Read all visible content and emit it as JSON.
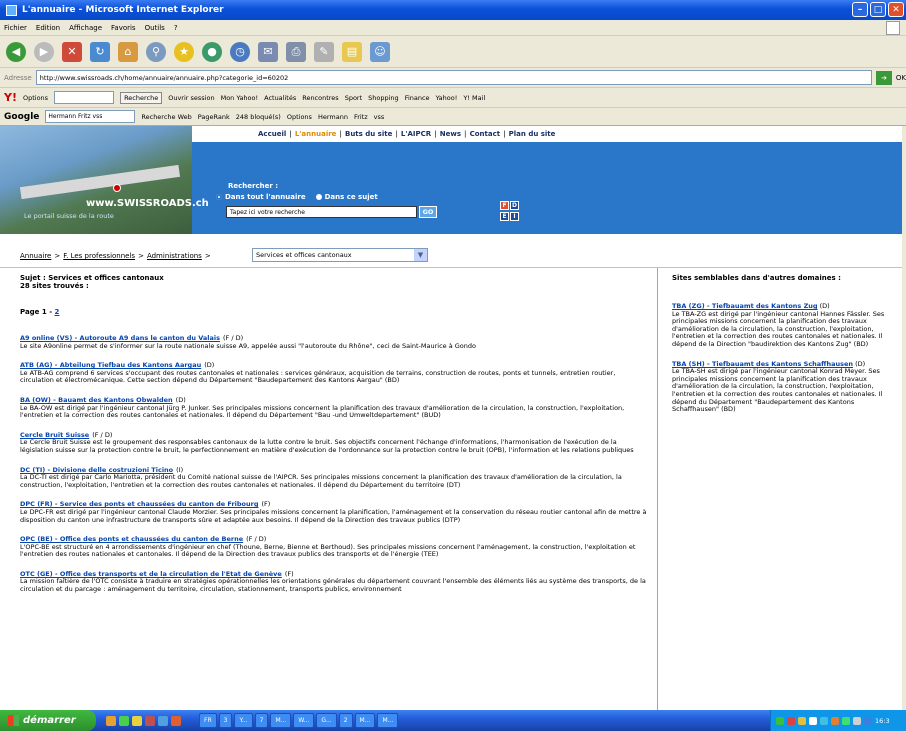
{
  "window": {
    "title": "L'annuaire - Microsoft Internet Explorer"
  },
  "menu": [
    "Fichier",
    "Edition",
    "Affichage",
    "Favoris",
    "Outils",
    "?"
  ],
  "addressbar": {
    "label": "Adresse",
    "url": "http://www.swissroads.ch/home/annuaire/annuaire.php?categorie_id=60202",
    "go": "OK"
  },
  "yahoo_bar": {
    "options": "Options",
    "search_button": "Recherche",
    "items": [
      "Ouvrir session",
      "Mon Yahoo!",
      "Actualités",
      "Rencontres",
      "Sport",
      "Shopping",
      "Finance",
      "Yahoo!",
      "Y! Mail"
    ]
  },
  "google_bar": {
    "logo": "Google",
    "query": "Hermann Fritz vss",
    "search_web": "Recherche Web",
    "pagerank": "PageRank",
    "blocked": "248 bloqué(s)",
    "options": "Options",
    "terms": [
      "Hermann",
      "Fritz",
      "vss"
    ]
  },
  "site": {
    "nav": [
      "Accueil",
      "L'annuaire",
      "Buts du site",
      "L'AIPCR",
      "News",
      "Contact",
      "Plan du site"
    ],
    "logo": "www.SWISSROADS.ch",
    "tagline": "Le portail suisse de la route",
    "search": {
      "label": "Rechercher :",
      "opt_all": "Dans tout l'annuaire",
      "opt_subject": "Dans ce sujet",
      "placeholder": "Tapez ici votre recherche",
      "go": "GO"
    },
    "languages": [
      "F",
      "D",
      "E",
      "I"
    ]
  },
  "breadcrumb": {
    "items": [
      "Annuaire",
      "F. Les professionnels",
      "Administrations"
    ],
    "sep": ">",
    "select": "Services et offices cantonaux"
  },
  "subject": {
    "line1": "Sujet : Services et offices cantonaux",
    "line2": "28 sites trouvés :"
  },
  "pager": {
    "label": "Page",
    "current": "1",
    "dash": "-",
    "next": "2"
  },
  "entries": [
    {
      "title": "A9 online (VS) - Autoroute A9 dans le canton du Valais",
      "lang": "(F / D)",
      "desc": "Le site A9online permet de s'informer sur la route nationale suisse A9, appelée aussi \"l'autoroute du Rhône\", ceci de Saint-Maurice à Gondo"
    },
    {
      "title": "ATB (AG) - Abteilung Tiefbau des Kantons Aargau",
      "lang": "(D)",
      "desc": "Le ATB-AG comprend 6 services s'occupant des routes cantonales et nationales : services généraux, acquisition de terrains, construction de routes, ponts et tunnels, entretien routier, circulation et électromécanique. Cette section dépend du Département \"Baudepartement des Kantons Aargau\" (BD)"
    },
    {
      "title": "BA (OW) - Bauamt des Kantons Obwalden",
      "lang": "(D)",
      "desc": "Le BA-OW est dirigé par l'ingénieur cantonal Jürg P. Junker. Ses principales missions concernent la planification des travaux d'amélioration de la circulation, la construction, l'exploitation, l'entretien et la correction des routes cantonales et nationales. Il dépend du Département \"Bau -und Umweltdepartement\" (BUD)"
    },
    {
      "title": "Cercle Bruit Suisse",
      "lang": "(F / D)",
      "desc": "Le Cercle Bruit Suisse est le groupement des responsables cantonaux de la lutte contre le bruit. Ses objectifs concernent l'échange d'informations, l'harmonisation de l'exécution de la législation suisse sur la protection contre le bruit, le perfectionnement en matière d'exécution de l'ordonnance sur la protection contre le bruit (OPB), l'information et les relations publiques"
    },
    {
      "title": "DC (TI) - Divisione delle costruzioni Ticino",
      "lang": "(I)",
      "desc": "La DC-TI est dirigé par Carlo Mariotta, président du Comité national suisse de l'AIPCR. Ses principales missions concernent la planification des travaux d'amélioration de la circulation, la construction, l'exploitation, l'entretien et la correction des routes cantonales et nationales. Il dépend du Département du territoire (DT)"
    },
    {
      "title": "DPC (FR) - Service des ponts et chaussées du canton de Fribourg",
      "lang": "(F)",
      "desc": "Le DPC-FR est dirigé par l'ingénieur cantonal Claude Morzier. Ses principales missions concernent la planification, l'aménagement et la conservation du réseau routier cantonal afin de mettre à disposition du canton une infrastructure de transports sûre et adaptée aux besoins. Il dépend de la Direction des travaux publics (DTP)"
    },
    {
      "title": "OPC (BE) - Office des ponts et chaussées du canton de Berne",
      "lang": "(F / D)",
      "desc": "L'OPC-BE est structuré en 4 arrondissements d'ingénieur en chef (Thoune, Berne, Bienne et Berthoud). Ses principales missions concernent l'aménagement, la construction, l'exploitation et l'entretien des routes nationales et cantonales. Il dépend de la Direction des travaux publics des transports et de l'énergie (TEE)"
    },
    {
      "title": "OTC (GE) - Office des transports et de la circulation de l'Etat de Genève",
      "lang": "(F)",
      "desc": "La mission faîtière de l'OTC consiste à traduire en stratégies opérationnelles les orientations générales du département couvrant l'ensemble des éléments liés au système des transports, de la circulation et du parcage : aménagement du territoire, circulation, stationnement, transports publics, environnement"
    }
  ],
  "sidebar": {
    "title": "Sites semblables dans d'autres domaines :",
    "entries": [
      {
        "title": "TBA (ZG) - Tiefbauamt des Kantons Zug",
        "lang": "(D)",
        "desc": "Le TBA-ZG est dirigé par l'ingénieur cantonal Hannes Fässler. Ses principales missions concernent la planification des travaux d'amélioration de la circulation, la construction, l'exploitation, l'entretien et la correction des routes cantonales et nationales. Il dépend de la Direction \"baudirektion des Kantons Zug\" (BD)"
      },
      {
        "title": "TBA (SH) - Tiefbauamt des Kantons Schaffhausen",
        "lang": "(D)",
        "desc": "Le TBA-SH est dirigé par l'ingénieur cantonal Konrad Meyer. Ses principales missions concernent la planification des travaux d'amélioration de la circulation, la construction, l'exploitation, l'entretien et la correction des routes cantonales et nationales. Il dépend du Département \"Baudepartement des Kantons Schaffhausen\" (BD)"
      }
    ]
  },
  "taskbar": {
    "start": "démarrer",
    "tasks": [
      "FR",
      "3",
      "Y...",
      "7",
      "M...",
      "W...",
      "G...",
      "2",
      "M...",
      "M..."
    ],
    "clock": "16:3"
  }
}
